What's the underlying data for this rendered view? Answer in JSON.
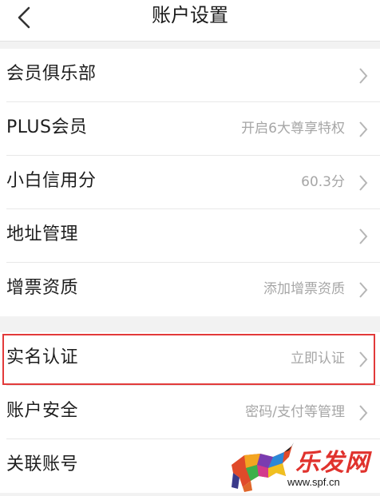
{
  "header": {
    "title": "账户设置",
    "back_icon": "chevron-left-icon"
  },
  "group1": [
    {
      "label": "会员俱乐部",
      "value": ""
    },
    {
      "label": "PLUS会员",
      "value": "开启6大尊享特权"
    },
    {
      "label": "小白信用分",
      "value": "60.3分"
    },
    {
      "label": "地址管理",
      "value": ""
    },
    {
      "label": "增票资质",
      "value": "添加增票资质"
    }
  ],
  "group2": [
    {
      "label": "实名认证",
      "value": "立即认证"
    },
    {
      "label": "账户安全",
      "value": "密码/支付等管理"
    },
    {
      "label": "关联账号",
      "value": ""
    }
  ],
  "highlight_color": "#e23a3a",
  "watermark": {
    "brand": "乐发网",
    "url": "www.spf.cn"
  }
}
